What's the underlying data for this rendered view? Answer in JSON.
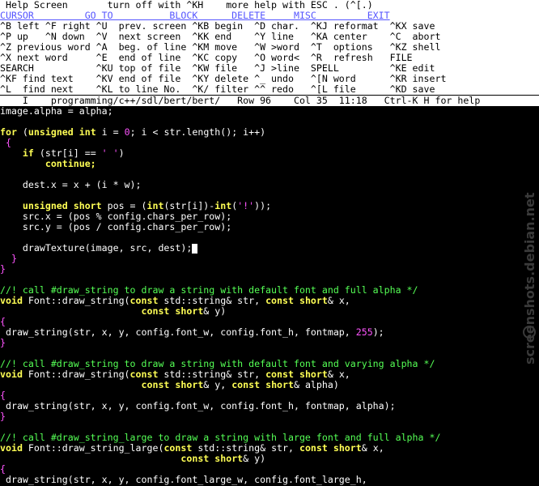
{
  "help": {
    "line0": " Help Screen       turn off with ^KH    more help with ESC . (^[.)",
    "line1": "CURSOR         GO TO          BLOCK      DELETE     MISC         EXIT",
    "line2": "^B left ^F right ^U  prev. screen ^KB begin  ^D char.  ^KJ reformat  ^KX save",
    "line3": "^P up   ^N down  ^V  next screen  ^KK end    ^Y line   ^KA center    ^C  abort",
    "line4": "^Z previous word ^A  beg. of line ^KM move   ^W >word  ^T  options   ^KZ shell",
    "line5": "^X next word     ^E  end of line  ^KC copy   ^O word<  ^R  refresh   FILE",
    "line6": "SEARCH           ^KU top of file  ^KW file   ^J >line  SPELL         ^KE edit",
    "line7": "^KF find text    ^KV end of file  ^KY delete ^_ undo   ^[N word      ^KR insert",
    "line8": "^L  find next    ^KL to line No.  ^K/ filter ^^ redo   ^[L file      ^KD save"
  },
  "status": "    I    programming/c++/sdl/bert/bert/   Row 96    Col 35  11:18   Ctrl-K H for help",
  "code": {
    "c1": "image.alpha = alpha;",
    "c2a": "for",
    "c2b": " (",
    "c2c": "unsigned int",
    "c2d": " i = ",
    "c2e": "0",
    "c2f": "; i < str.length(); i++)",
    "c3": " {",
    "c4a": "    ",
    "c4b": "if",
    "c4c": " (str[i] == ",
    "c4d": "' '",
    "c4e": ")",
    "c5": "        continue;",
    "c7": "    dest.x = x + (i * w);",
    "c9a": "    unsigned short",
    "c9b": " pos = (",
    "c9c": "int",
    "c9d": "(str[i])-",
    "c9e": "int",
    "c9f": "(",
    "c9g": "'!'",
    "c9h": "));",
    "c10": "    src.x = (pos % config.chars_per_row);",
    "c11": "    src.y = (pos / config.chars_per_row);",
    "c13": "    drawTexture(image, src, dest);",
    "c14": "  }",
    "c15": "}",
    "cm1": "//! call #draw_string to draw a string with default font and full alpha */",
    "f1a": "void",
    "f1b": " Font::draw_string(",
    "f1c": "const",
    "f1d": " std::string& str, ",
    "f1e": "const short",
    "f1f": "& x,",
    "f1g": "                         ",
    "f1h": "const short",
    "f1i": "& y)",
    "b1": "{",
    "d1a": " draw_string(str, x, y, config.font_w, config.font_h, fontmap, ",
    "d1b": "255",
    "d1c": ");",
    "b2": "}",
    "cm2": "//! call #draw_string to draw a string with default font and varying alpha */",
    "f2a": "void",
    "f2b": " Font::draw_string(",
    "f2c": "const",
    "f2d": " std::string& str, ",
    "f2e": "const short",
    "f2f": "& x,",
    "f2g": "                         ",
    "f2h": "const short",
    "f2i": "& y, ",
    "f2j": "const short",
    "f2k": "& alpha)",
    "b3": "{",
    "d2": " draw_string(str, x, y, config.font_w, config.font_h, fontmap, alpha);",
    "b4": "}",
    "cm3": "//! call #draw_string_large to draw a string with large font and full alpha */",
    "f3a": "void",
    "f3b": " Font::draw_string_large(",
    "f3c": "const",
    "f3d": " std::string& str, ",
    "f3e": "const short",
    "f3f": "& x,",
    "f3g": "                                ",
    "f3h": "const short",
    "f3i": "& y)",
    "b5": "{",
    "d3": " draw_string(str, x, y, config.font_large_w, config.font_large_h,"
  },
  "watermark": "screenshots.debian.net",
  "colors": {
    "keyword": "#ffff55",
    "comment": "#55ff55",
    "literal": "#ff55ff",
    "help_heading": "#5555ff"
  }
}
